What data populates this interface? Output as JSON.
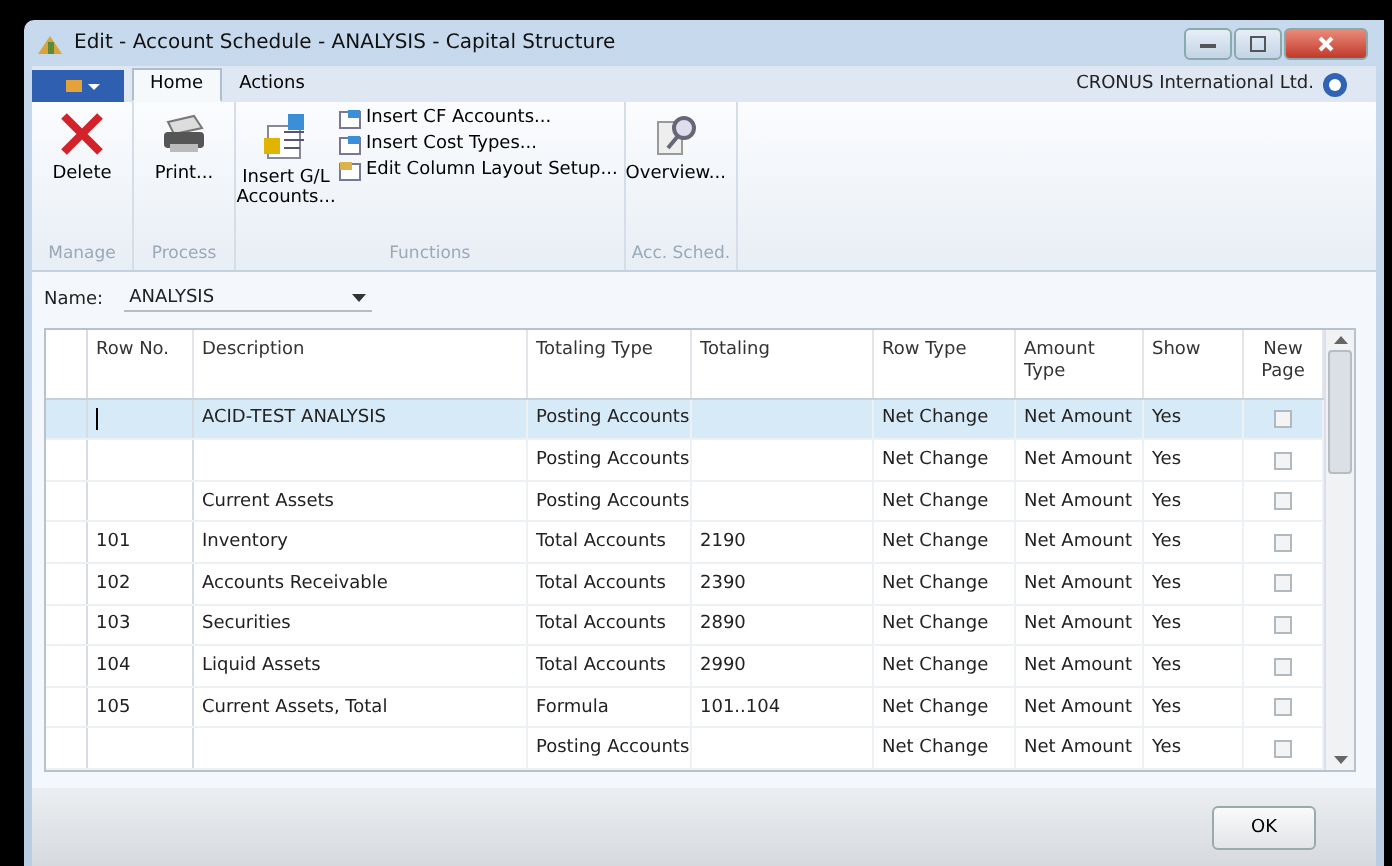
{
  "window": {
    "title": "Edit - Account Schedule - ANALYSIS - Capital Structure"
  },
  "ribbon": {
    "tabs": [
      {
        "label": "Home",
        "selected": true
      },
      {
        "label": "Actions",
        "selected": false
      }
    ],
    "company": "CRONUS International Ltd.",
    "groups": [
      {
        "label": "Manage",
        "buttons": [
          {
            "kind": "delete",
            "label": "Delete"
          }
        ]
      },
      {
        "label": "Process",
        "buttons": [
          {
            "kind": "print",
            "label": "Print..."
          }
        ]
      },
      {
        "label": "Functions",
        "buttons": [
          {
            "kind": "insert",
            "label": "Insert G/L Accounts..."
          }
        ],
        "small": [
          "Insert CF Accounts...",
          "Insert Cost Types...",
          "Edit Column Layout Setup..."
        ]
      },
      {
        "label": "Acc. Sched.",
        "buttons": [
          {
            "kind": "overview",
            "label": "Overview..."
          }
        ]
      }
    ]
  },
  "name_field": {
    "label": "Name:",
    "value": "ANALYSIS"
  },
  "table": {
    "columns": [
      "Row No.",
      "Description",
      "Totaling Type",
      "Totaling",
      "Row Type",
      "Amount Type",
      "Show",
      "New Page"
    ],
    "rows": [
      {
        "row_no": "",
        "description": "ACID-TEST ANALYSIS",
        "totaling_type": "Posting Accounts",
        "totaling": "",
        "row_type": "Net Change",
        "amount_type": "Net Amount",
        "show": "Yes",
        "new_page": false,
        "selected": true
      },
      {
        "row_no": "",
        "description": "",
        "totaling_type": "Posting Accounts",
        "totaling": "",
        "row_type": "Net Change",
        "amount_type": "Net Amount",
        "show": "Yes",
        "new_page": false,
        "selected": false
      },
      {
        "row_no": "",
        "description": "Current Assets",
        "totaling_type": "Posting Accounts",
        "totaling": "",
        "row_type": "Net Change",
        "amount_type": "Net Amount",
        "show": "Yes",
        "new_page": false,
        "selected": false
      },
      {
        "row_no": "101",
        "description": "Inventory",
        "totaling_type": "Total Accounts",
        "totaling": "2190",
        "row_type": "Net Change",
        "amount_type": "Net Amount",
        "show": "Yes",
        "new_page": false,
        "selected": false
      },
      {
        "row_no": "102",
        "description": "Accounts Receivable",
        "totaling_type": "Total Accounts",
        "totaling": "2390",
        "row_type": "Net Change",
        "amount_type": "Net Amount",
        "show": "Yes",
        "new_page": false,
        "selected": false
      },
      {
        "row_no": "103",
        "description": "Securities",
        "totaling_type": "Total Accounts",
        "totaling": "2890",
        "row_type": "Net Change",
        "amount_type": "Net Amount",
        "show": "Yes",
        "new_page": false,
        "selected": false
      },
      {
        "row_no": "104",
        "description": "Liquid Assets",
        "totaling_type": "Total Accounts",
        "totaling": "2990",
        "row_type": "Net Change",
        "amount_type": "Net Amount",
        "show": "Yes",
        "new_page": false,
        "selected": false
      },
      {
        "row_no": "105",
        "description": "Current Assets, Total",
        "totaling_type": "Formula",
        "totaling": "101..104",
        "row_type": "Net Change",
        "amount_type": "Net Amount",
        "show": "Yes",
        "new_page": false,
        "selected": false
      },
      {
        "row_no": "",
        "description": "",
        "totaling_type": "Posting Accounts",
        "totaling": "",
        "row_type": "Net Change",
        "amount_type": "Net Amount",
        "show": "Yes",
        "new_page": false,
        "selected": false
      }
    ]
  },
  "buttons": [
    "OK"
  ]
}
